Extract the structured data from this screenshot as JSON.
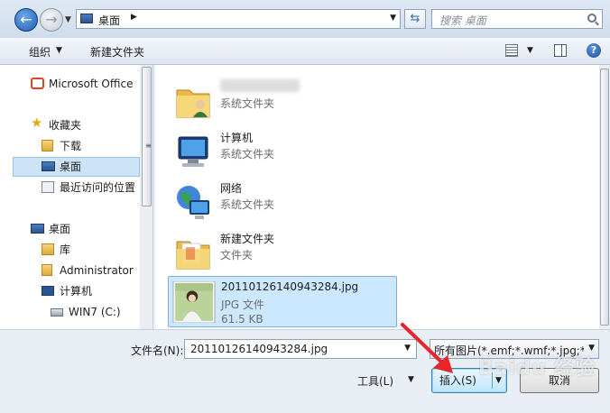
{
  "address": {
    "location": "桌面"
  },
  "search": {
    "placeholder": "搜索 桌面"
  },
  "toolbar": {
    "organize": "组织",
    "new_folder": "新建文件夹"
  },
  "nav": {
    "items": [
      {
        "label": "Microsoft Office",
        "icon": "office-icon"
      },
      {
        "label": "收藏夹",
        "icon": "star-icon"
      },
      {
        "label": "下载",
        "icon": "download-folder-icon"
      },
      {
        "label": "桌面",
        "icon": "desktop-icon",
        "selected": true
      },
      {
        "label": "最近访问的位置",
        "icon": "recent-places-icon"
      },
      {
        "label": "桌面",
        "icon": "desktop-icon"
      },
      {
        "label": "库",
        "icon": "library-icon"
      },
      {
        "label": "Administrator",
        "icon": "user-folder-icon"
      },
      {
        "label": "计算机",
        "icon": "computer-icon"
      },
      {
        "label": "WIN7 (C:)",
        "icon": "drive-icon"
      }
    ]
  },
  "files": [
    {
      "name": "",
      "type": "系统文件夹",
      "icon": "user-folder-icon"
    },
    {
      "name": "计算机",
      "type": "系统文件夹",
      "icon": "computer-icon"
    },
    {
      "name": "网络",
      "type": "系统文件夹",
      "icon": "network-icon"
    },
    {
      "name": "新建文件夹",
      "type": "文件夹",
      "icon": "folder-icon"
    },
    {
      "name": "20110126140943284.jpg",
      "type": "JPG 文件",
      "size": "61.5 KB",
      "icon": "image-thumbnail",
      "selected": true
    }
  ],
  "bottom": {
    "filename_label": "文件名(N):",
    "filename_value": "20110126140943284.jpg",
    "filter_value": "所有图片(*.emf;*.wmf;*.jpg;*.jp",
    "tools_label": "工具(L)",
    "insert_label": "插入(S)",
    "cancel_label": "取消"
  },
  "watermark": "Baidu 经验",
  "colors": {
    "selection": "#cce8ff",
    "accent": "#3c7fb1",
    "arrow": "#e8262a"
  }
}
